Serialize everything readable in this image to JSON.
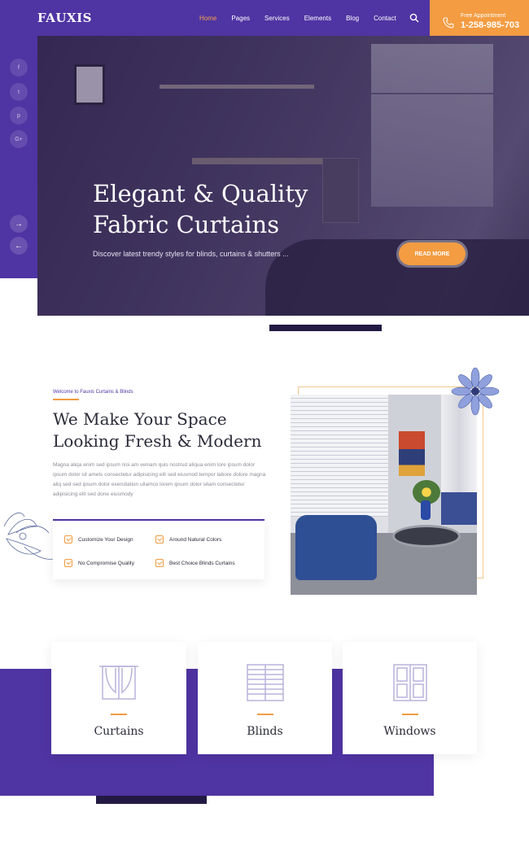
{
  "header": {
    "logo": "FAUXIS",
    "nav": [
      "Home",
      "Pages",
      "Services",
      "Elements",
      "Blog",
      "Contact"
    ],
    "active_nav": "Home",
    "appointment_label": "Free Appointment",
    "appointment_phone": "1-258-985-703"
  },
  "sidebar": {
    "social": [
      {
        "label": "f",
        "icon": "facebook-icon"
      },
      {
        "label": "t",
        "icon": "twitter-icon"
      },
      {
        "label": "p",
        "icon": "pinterest-icon"
      },
      {
        "label": "G+",
        "icon": "google-plus-icon"
      }
    ],
    "next_arrow": "→",
    "prev_arrow": "←"
  },
  "hero": {
    "title_line1": "Elegant & Quality",
    "title_line2": "Fabric Curtains",
    "subtitle": "Discover latest trendy styles for blinds, curtains & shutters ...",
    "button": "READ MORE"
  },
  "about": {
    "eyebrow": "Welcome to Fauxis Curtains & Blinds",
    "title_line1": "We Make Your Space",
    "title_line2": "Looking Fresh & Modern",
    "text": "Magna aliqa enim sed ipsum nisi am veniam quis nostrud aliqua enim lore ipsum dolor ipsum dolor sit amets consectetur adipisicing elit sed eiusmod tempor labore dolore magna aliq sed sed ipsum dolor exercitation ullamco lorem ipsum dolor sitam consectetur adipisicing elit sed done eiusmody",
    "features": [
      "Customize Your Design",
      "Around Natural Colors",
      "No Compromise Quality",
      "Best Choice Blinds Curtains"
    ]
  },
  "services": [
    {
      "name": "Curtains",
      "icon": "curtains-icon"
    },
    {
      "name": "Blinds",
      "icon": "blinds-icon"
    },
    {
      "name": "Windows",
      "icon": "windows-icon"
    }
  ],
  "colors": {
    "primary": "#4f34a3",
    "accent": "#f39c42"
  }
}
